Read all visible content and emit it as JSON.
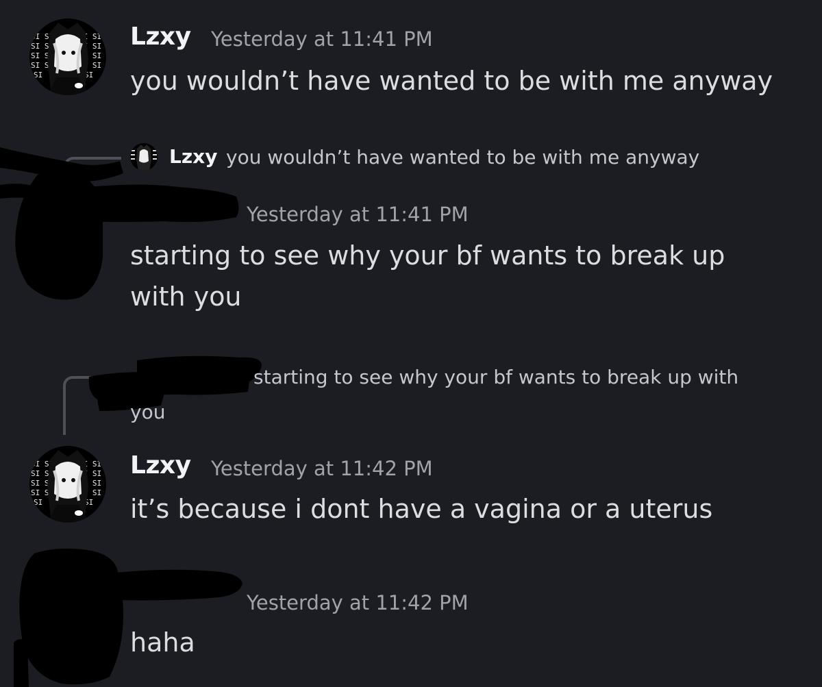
{
  "messages": [
    {
      "author": "Lzxy",
      "timestamp": "Yesterday at 11:41 PM",
      "content": "you wouldn’t have wanted to be with me anyway"
    },
    {
      "reply_author": "Lzxy",
      "reply_text": "you wouldn’t have wanted to be with me anyway",
      "timestamp": "Yesterday at 11:41 PM",
      "content_line1": "starting to see why your bf wants to break up",
      "content_line2": "with you"
    },
    {
      "reply_text_line1": "starting to see why your bf wants to break up with",
      "reply_text_line2": "you",
      "author": "Lzxy",
      "timestamp": "Yesterday at 11:42 PM",
      "content": "it’s because i dont have a vagina or a uterus"
    },
    {
      "timestamp": "Yesterday at 11:42 PM",
      "content": "haha"
    }
  ],
  "colors": {
    "background": "#1c1d22",
    "text": "#dbdee1",
    "muted": "#a0a3ab",
    "redaction": "#000000"
  }
}
